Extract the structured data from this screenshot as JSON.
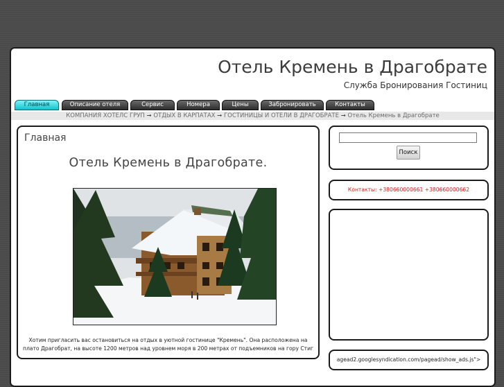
{
  "header": {
    "title": "Отель Кремень в Драгобрате",
    "subtitle": "Служба Бронирования Гостиниц"
  },
  "menu": {
    "items": [
      {
        "label": "Главная",
        "active": true
      },
      {
        "label": "Описание отеля"
      },
      {
        "label": "Сервис"
      },
      {
        "label": "Номера"
      },
      {
        "label": "Цены"
      },
      {
        "label": "Забронировать"
      },
      {
        "label": "Контакты"
      }
    ]
  },
  "breadcrumb": {
    "items": [
      "КОМПАНИЯ ХОТЕЛС ГРУП",
      "ОТДЫХ В КАРПАТАХ",
      "ГОСТИНИЦЫ И ОТЕЛИ В ДРАГОБРАТЕ",
      "Отель Кремень в Драгобрате"
    ],
    "separator": "➞"
  },
  "main": {
    "heading": "Главная",
    "article_title": "Отель Кремень в Драгобрате.",
    "text": "Хотим пригласить вас остановиться на отдых в уютной гостинице \"Кремень\". Она расположена на плато Драгобрат, на высоте 1200 метров над уровнем моря в 200 метрах от подъемников на гору Стиг"
  },
  "sidebar": {
    "search": {
      "value": "",
      "button_label": "Поиск"
    },
    "contacts": "Контакты: +380660000661 +380660000662",
    "script_text": "agead2.googlesyndication.com/pagead/show_ads.js\">"
  },
  "colors": {
    "accent_tab": "#13c3cf",
    "contacts_text": "#d41b1b",
    "background": "#4a4a4a"
  }
}
